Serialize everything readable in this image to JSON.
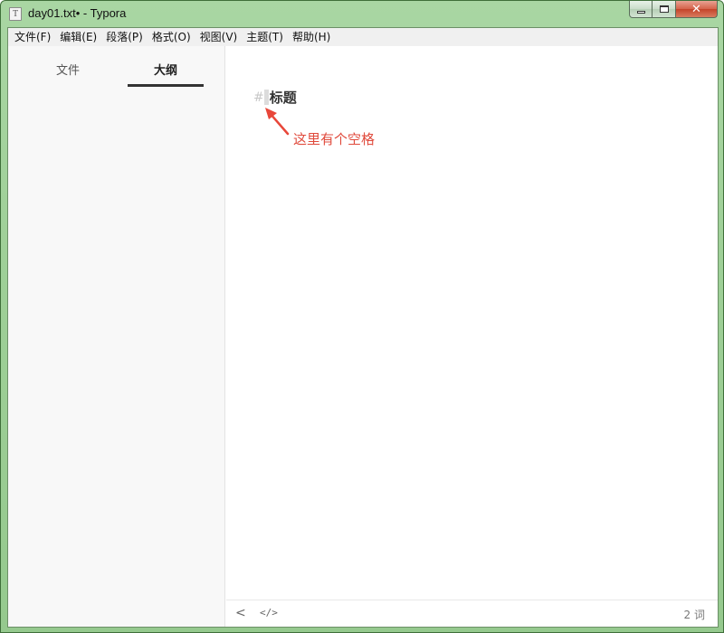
{
  "window": {
    "title": "day01.txt• - Typora",
    "app_icon_letter": "T"
  },
  "menu": [
    {
      "label": "文件(F)"
    },
    {
      "label": "编辑(E)"
    },
    {
      "label": "段落(P)"
    },
    {
      "label": "格式(O)"
    },
    {
      "label": "视图(V)"
    },
    {
      "label": "主题(T)"
    },
    {
      "label": "帮助(H)"
    }
  ],
  "sidebar": {
    "tabs": {
      "files": "文件",
      "outline": "大纲"
    },
    "active_tab": "outline"
  },
  "editor": {
    "heading_marker": "#",
    "heading_text": "标题",
    "annotation": "这里有个空格",
    "annotation_color": "#e04a3c"
  },
  "statusbar": {
    "back_glyph": "<",
    "source_glyph": "</>",
    "word_count": "2 词"
  }
}
